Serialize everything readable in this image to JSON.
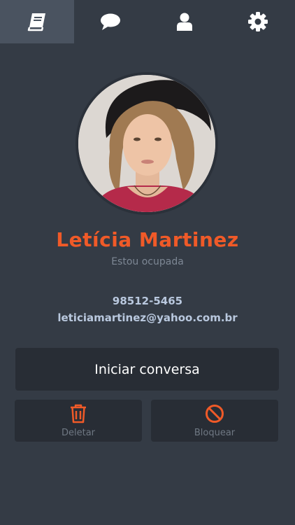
{
  "theme": {
    "accent": "#f05a28",
    "background": "#343b45",
    "card": "#282d35",
    "tab_active": "#4a5360",
    "text_muted": "#7d8794",
    "text_contact": "#b9c8de"
  },
  "tabs": [
    {
      "icon": "book-icon",
      "active": true
    },
    {
      "icon": "chat-bubble-icon",
      "active": false
    },
    {
      "icon": "user-icon",
      "active": false
    },
    {
      "icon": "gear-icon",
      "active": false
    }
  ],
  "profile": {
    "name": "Letícia Martinez",
    "status": "Estou ocupada",
    "phone": "98512-5465",
    "email": "leticiamartinez@yahoo.com.br"
  },
  "actions": {
    "start_chat": "Iniciar conversa",
    "delete": "Deletar",
    "block": "Bloquear"
  }
}
